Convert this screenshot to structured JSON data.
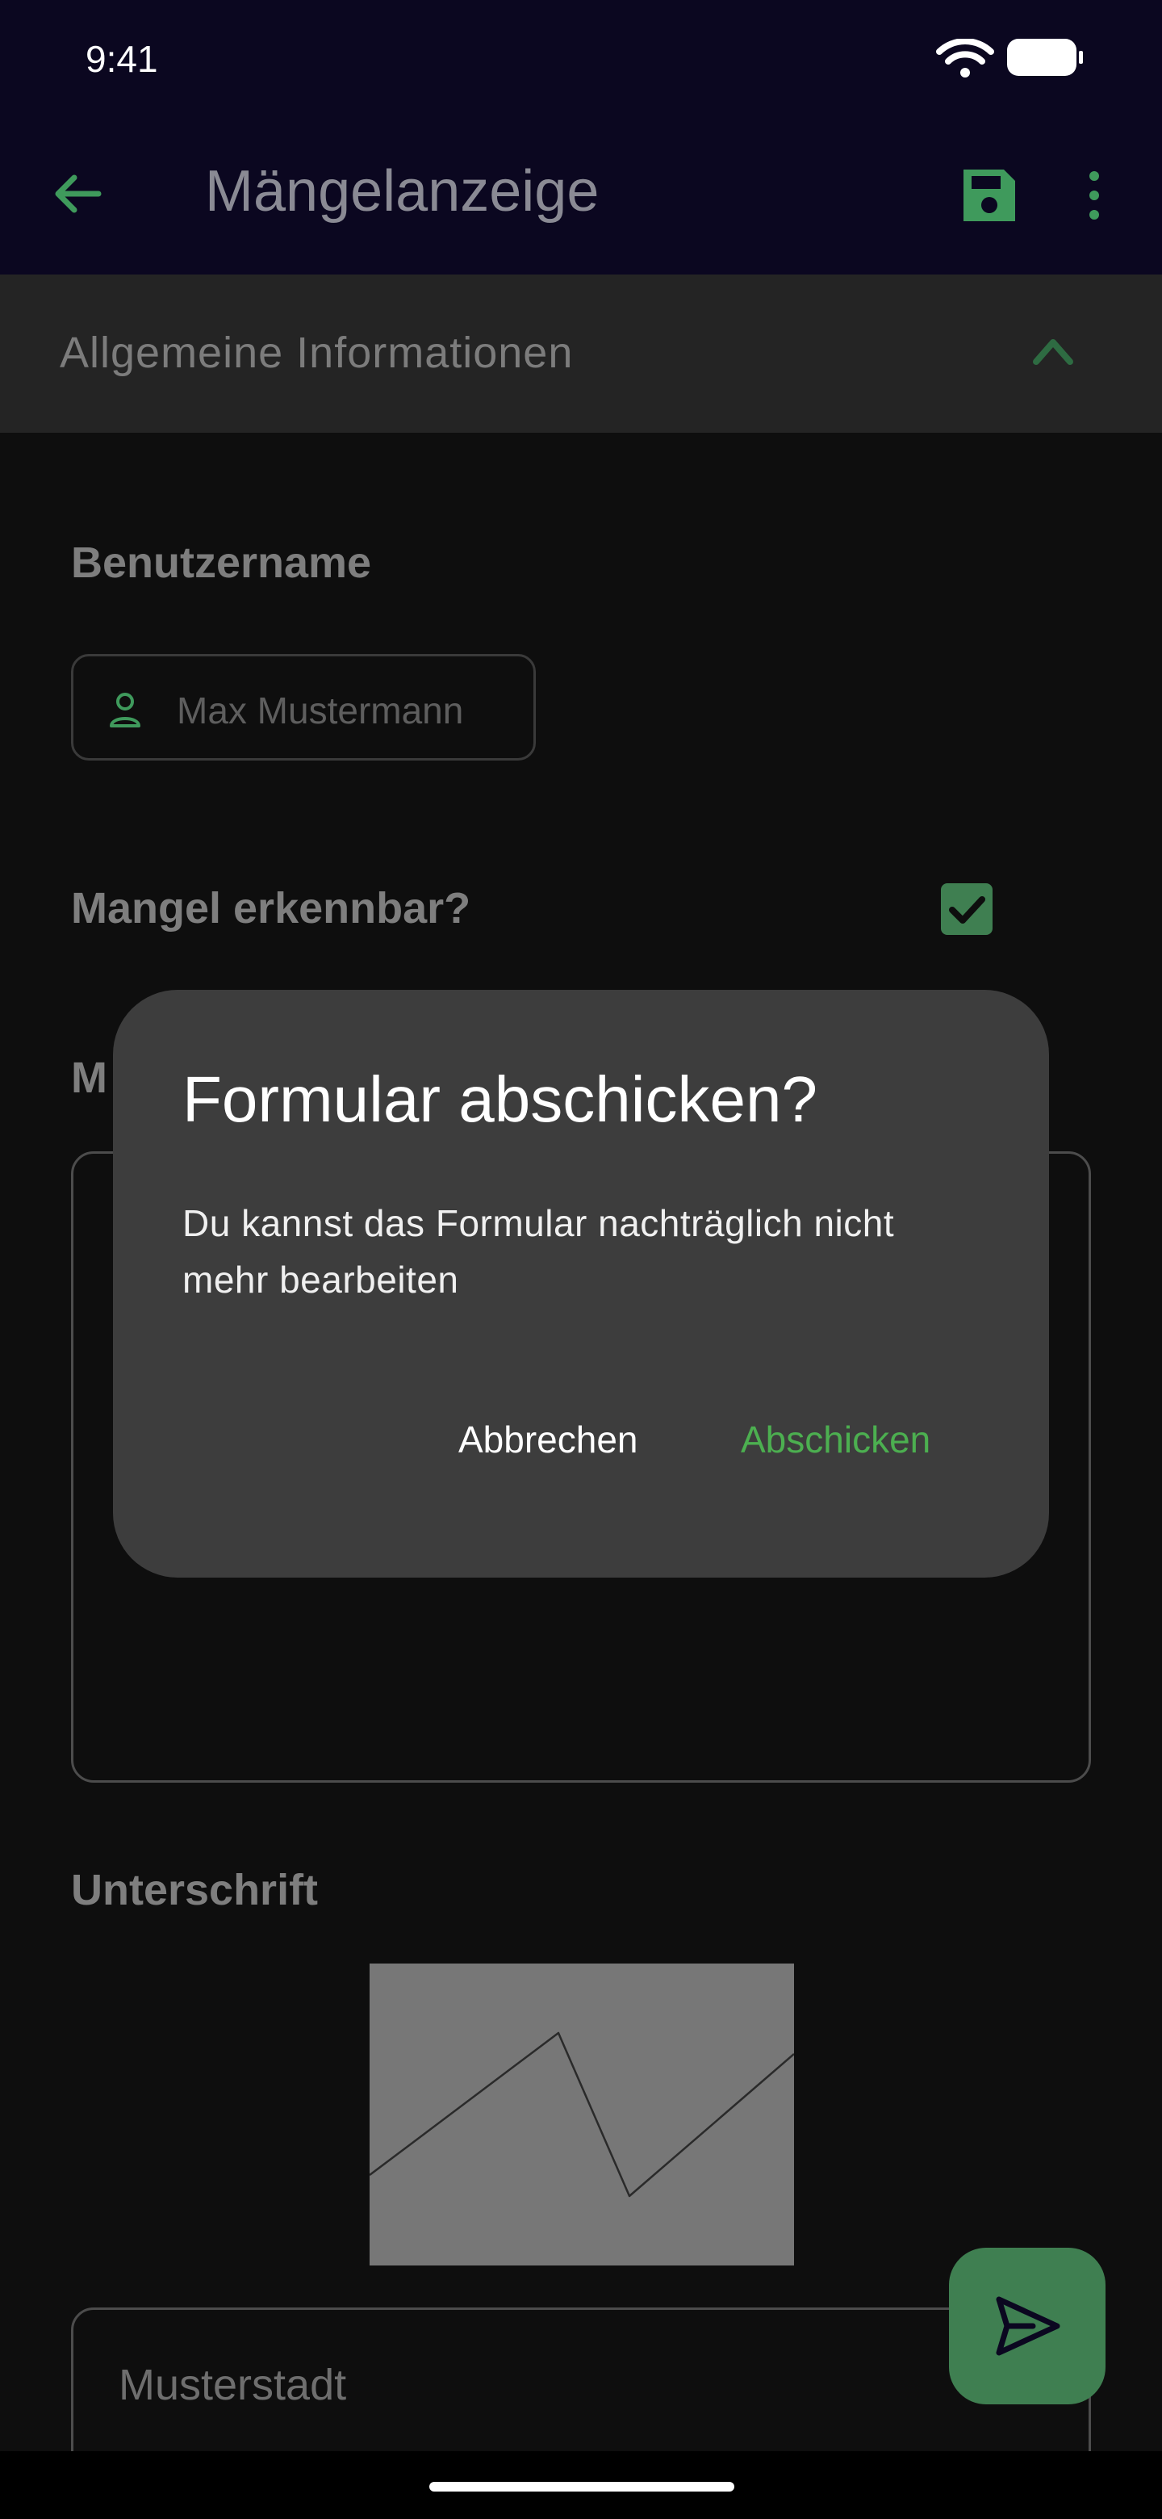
{
  "status_bar": {
    "time": "9:41"
  },
  "app_bar": {
    "title": "Mängelanzeige"
  },
  "section": {
    "title": "Allgemeine Informationen"
  },
  "form": {
    "username_label": "Benutzername",
    "username_value": "Max Mustermann",
    "defect_visible_label": "Mangel erkennbar?",
    "defect_visible_checked": true,
    "description_label_partial": "M",
    "signature_label": "Unterschrift",
    "city_value": "Musterstadt"
  },
  "dialog": {
    "title": "Formular abschicken?",
    "message": "Du kannst das Formular nachträglich nicht mehr bearbeiten",
    "cancel_label": "Abbrechen",
    "submit_label": "Abschicken"
  },
  "colors": {
    "accent": "#4caf50",
    "bar_background": "#0b0720",
    "dialog_background": "#3d3d3d"
  }
}
